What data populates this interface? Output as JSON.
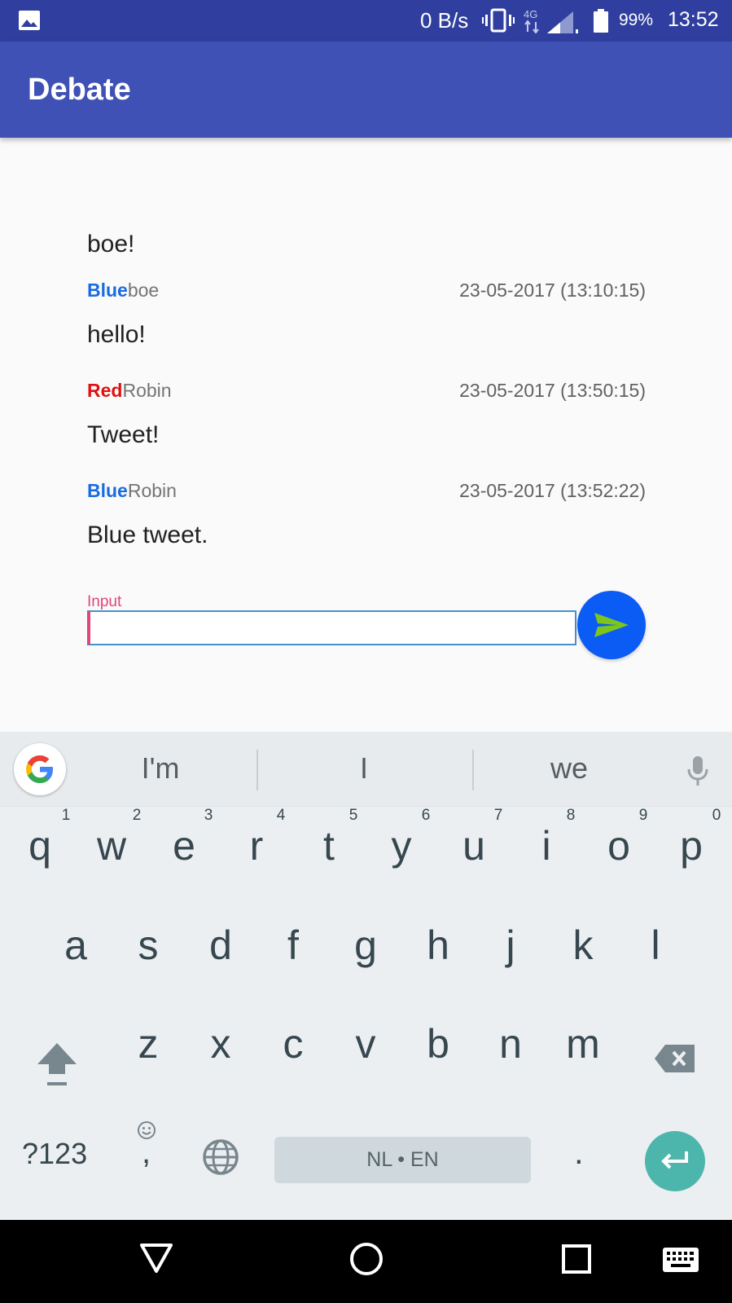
{
  "status_bar": {
    "net_speed": "0 B/s",
    "network_type": "4G",
    "battery_percent": "99%",
    "clock": "13:52"
  },
  "app_bar": {
    "title": "Debate"
  },
  "messages": {
    "first_text": "boe!",
    "items": [
      {
        "team": "Blue",
        "team_color": "#1a6be0",
        "author": "boe",
        "time": "23-05-2017 (13:10:15)",
        "text": "hello!"
      },
      {
        "team": "Red",
        "team_color": "#e01010",
        "author": "Robin",
        "time": "23-05-2017 (13:50:15)",
        "text": "Tweet!"
      },
      {
        "team": "Blue",
        "team_color": "#1a6be0",
        "author": "Robin",
        "time": "23-05-2017 (13:52:22)",
        "text": "Blue tweet."
      }
    ]
  },
  "input": {
    "label": "Input",
    "value": ""
  },
  "colors": {
    "primary": "#3f51b5",
    "primary_dark": "#303f9f",
    "accent": "#e0457b",
    "send_button": "#0a5cf5",
    "send_arrow": "#7cc51c"
  },
  "keyboard": {
    "suggestions": [
      "I'm",
      "I",
      "we"
    ],
    "row1": [
      "q",
      "w",
      "e",
      "r",
      "t",
      "y",
      "u",
      "i",
      "o",
      "p"
    ],
    "row1_hints": [
      "1",
      "2",
      "3",
      "4",
      "5",
      "6",
      "7",
      "8",
      "9",
      "0"
    ],
    "row2": [
      "a",
      "s",
      "d",
      "f",
      "g",
      "h",
      "j",
      "k",
      "l"
    ],
    "row3": [
      "z",
      "x",
      "c",
      "v",
      "b",
      "n",
      "m"
    ],
    "symbols_label": "?123",
    "comma_label": ",",
    "space_label": "NL • EN",
    "period_label": "."
  },
  "icons": {
    "status": [
      "gallery-icon",
      "vibrate-icon",
      "signal-icon",
      "battery-icon"
    ],
    "nav": [
      "back-icon",
      "home-icon",
      "recents-icon",
      "keyboard-icon"
    ]
  }
}
